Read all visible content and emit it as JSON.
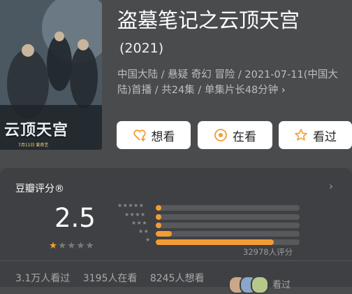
{
  "movie": {
    "title": "盗墓笔记之云顶天宫",
    "year": "(2021)",
    "meta_text": "中国大陆 / 悬疑 奇幻 冒险 / 2021-07-11(中国大陆)首播 / 共24集 / 单集片长48分钟",
    "meta_chevron": "›",
    "poster_title": "云顶天宫",
    "poster_date": "7月11日 爱奇艺"
  },
  "actions": {
    "want_label": "想看",
    "watching_label": "在看",
    "watched_label": "看过"
  },
  "rating": {
    "card_title": "豆瓣评分®",
    "chevron": "›",
    "score": "2.5",
    "stars_filled": 1,
    "stars_total": 5,
    "distribution": [
      {
        "stars": "★★★★★",
        "fraction": 0.02
      },
      {
        "stars": "★★★★",
        "fraction": 0.02
      },
      {
        "stars": "★★★",
        "fraction": 0.03
      },
      {
        "stars": "★★",
        "fraction": 0.11
      },
      {
        "stars": "★",
        "fraction": 0.82
      }
    ],
    "count_label": "32978人评分"
  },
  "stats": {
    "watched": "3.1万人看过",
    "watching": "3195人在看",
    "want": "8245人想看",
    "more": "看过"
  },
  "colors": {
    "accent": "#f39c34",
    "background": "#4a4b4d",
    "card": "#3f4043"
  }
}
